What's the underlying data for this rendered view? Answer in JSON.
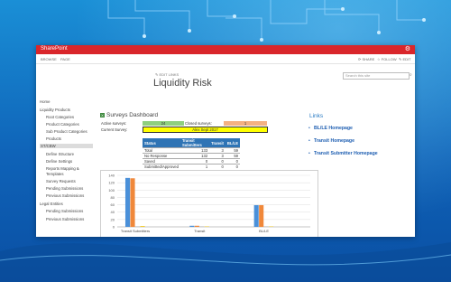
{
  "app": {
    "name": "SharePoint"
  },
  "ribbon": {
    "tabs": [
      "BROWSE",
      "PAGE"
    ],
    "actions": [
      "SHARE",
      "FOLLOW",
      "EDIT"
    ]
  },
  "page": {
    "edit_links": "EDIT LINKS",
    "title": "Liquidity Risk"
  },
  "search": {
    "placeholder": "Search this site"
  },
  "nav": {
    "items": [
      {
        "label": "Home",
        "level": 0
      },
      {
        "label": "Liquidity Products",
        "level": 0
      },
      {
        "label": "Root Categories",
        "level": 1
      },
      {
        "label": "Product Categories",
        "level": 1
      },
      {
        "label": "Sub Product Categories",
        "level": 1
      },
      {
        "label": "Products",
        "level": 1
      },
      {
        "label": "ST/CBW",
        "level": 0,
        "selected": true
      },
      {
        "label": "Define Structure",
        "level": 1
      },
      {
        "label": "Define Settings",
        "level": 1
      },
      {
        "label": "Reports Mapping &",
        "level": 1
      },
      {
        "label": "Templates",
        "level": 1
      },
      {
        "label": "Survey Requests",
        "level": 1
      },
      {
        "label": "Pending Submissions",
        "level": 1
      },
      {
        "label": "Previous Submissions",
        "level": 1
      },
      {
        "label": "Legal Entities",
        "level": 0
      },
      {
        "label": "Pending Submissions",
        "level": 1
      },
      {
        "label": "Previous Submissions",
        "level": 1
      }
    ]
  },
  "dashboard": {
    "title": "Surveys Dashboard",
    "active_label": "Active surveys:",
    "active_value": "24",
    "closed_label": "Closed surveys:",
    "closed_value": "1",
    "current_label": "Current Survey:",
    "current_value": "Alex Sept 2017",
    "table": {
      "headers": [
        "Status",
        "Transit Submitters",
        "Transit",
        "BL/LE"
      ],
      "rows": [
        [
          "Total",
          "133",
          "3",
          "59"
        ],
        [
          "No Response",
          "132",
          "3",
          "59"
        ],
        [
          "Saved",
          "0",
          "0",
          "0"
        ],
        [
          "Submitted/Approved",
          "1",
          "0",
          "0"
        ]
      ]
    }
  },
  "links": {
    "title": "Links",
    "items": [
      "BL/LE Homepage",
      "Transit Homepage",
      "Transit Submitter Homepage"
    ]
  },
  "chart_data": {
    "type": "bar",
    "categories": [
      "Transit Submitters",
      "Transit",
      "BL/LE"
    ],
    "series": [
      {
        "values": [
          133,
          3,
          59
        ],
        "color": "#4a90d9"
      },
      {
        "values": [
          132,
          3,
          59
        ],
        "color": "#f0883a"
      },
      {
        "values": [
          0,
          0,
          0
        ],
        "color": "#a6a6a6"
      },
      {
        "values": [
          1,
          0,
          0
        ],
        "color": "#f2c200"
      }
    ],
    "ylim": [
      0,
      140
    ],
    "yticks": [
      0,
      20,
      40,
      60,
      80,
      100,
      120,
      140
    ],
    "grid": true
  },
  "colors": {
    "suitebar": "#d9262b",
    "active_cell": "#8fcf7f",
    "closed_cell": "#f4b183",
    "current_cell": "#ffff00",
    "table_header": "#2f74b5"
  }
}
